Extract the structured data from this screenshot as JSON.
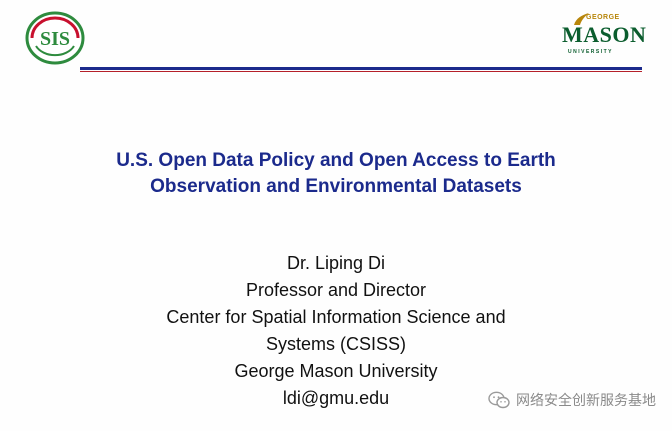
{
  "header": {
    "left_logo_text": "SIS",
    "right_logo": {
      "line1": "GEORGE",
      "line2": "MASON",
      "line3": "UNIVERSITY"
    }
  },
  "title_lines": [
    "U.S. Open Data Policy and Open Access to Earth",
    "Observation and Environmental Datasets"
  ],
  "author": {
    "name": "Dr. Liping Di",
    "role": "Professor and Director",
    "center_line1": "Center for Spatial Information Science and",
    "center_line2": "Systems (CSISS)",
    "university": "George Mason University",
    "email": "ldi@gmu.edu"
  },
  "watermark": {
    "text": "网络安全创新服务基地",
    "icon": "wechat-icon"
  },
  "colors": {
    "title": "#1b2a8c",
    "rule_blue": "#1b2a8c",
    "rule_red": "#b5202a",
    "mason_green": "#0b5d2e",
    "mason_gold": "#b8860b"
  }
}
